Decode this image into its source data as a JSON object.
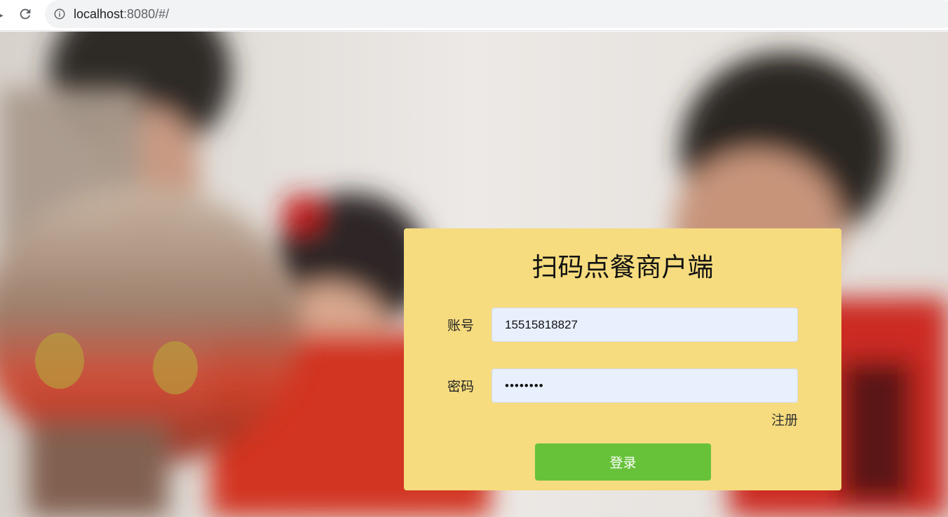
{
  "browser": {
    "url_host": "localhost",
    "url_rest": ":8080/#/"
  },
  "login": {
    "title": "扫码点餐商户端",
    "account_label": "账号",
    "account_value": "15515818827",
    "password_label": "密码",
    "password_value": "12345678",
    "register_link": "注册",
    "login_button": "登录"
  },
  "colors": {
    "card_background": "#f6dc7f",
    "input_background": "#e8f0fe",
    "login_button": "#67c23a"
  },
  "icons": {
    "back": "back-arrow-icon",
    "reload": "reload-icon",
    "site_info": "info-icon"
  }
}
